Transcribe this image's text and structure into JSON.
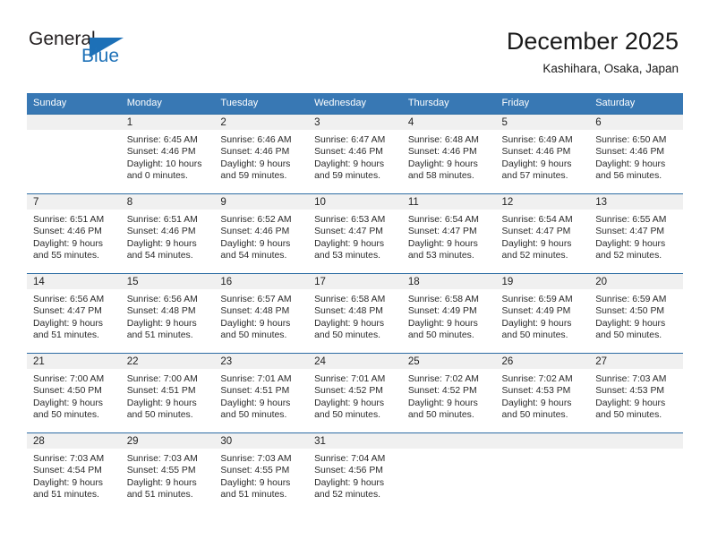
{
  "brand": {
    "name_top": "General",
    "name_bottom": "Blue",
    "accent_color": "#1d70b7",
    "logo_icon": "triangle-icon"
  },
  "header": {
    "title": "December 2025",
    "subtitle": "Kashihara, Osaka, Japan"
  },
  "calendar": {
    "header_bg": "#3878b4",
    "row_separator_color": "#2e6da4",
    "daynum_band_bg": "#f0f0f0",
    "weekdays": [
      "Sunday",
      "Monday",
      "Tuesday",
      "Wednesday",
      "Thursday",
      "Friday",
      "Saturday"
    ],
    "weeks": [
      [
        {
          "day": "",
          "sunrise": "",
          "sunset": "",
          "daylight_line1": "",
          "daylight_line2": "",
          "empty": true
        },
        {
          "day": "1",
          "sunrise": "Sunrise: 6:45 AM",
          "sunset": "Sunset: 4:46 PM",
          "daylight_line1": "Daylight: 10 hours",
          "daylight_line2": "and 0 minutes."
        },
        {
          "day": "2",
          "sunrise": "Sunrise: 6:46 AM",
          "sunset": "Sunset: 4:46 PM",
          "daylight_line1": "Daylight: 9 hours",
          "daylight_line2": "and 59 minutes."
        },
        {
          "day": "3",
          "sunrise": "Sunrise: 6:47 AM",
          "sunset": "Sunset: 4:46 PM",
          "daylight_line1": "Daylight: 9 hours",
          "daylight_line2": "and 59 minutes."
        },
        {
          "day": "4",
          "sunrise": "Sunrise: 6:48 AM",
          "sunset": "Sunset: 4:46 PM",
          "daylight_line1": "Daylight: 9 hours",
          "daylight_line2": "and 58 minutes."
        },
        {
          "day": "5",
          "sunrise": "Sunrise: 6:49 AM",
          "sunset": "Sunset: 4:46 PM",
          "daylight_line1": "Daylight: 9 hours",
          "daylight_line2": "and 57 minutes."
        },
        {
          "day": "6",
          "sunrise": "Sunrise: 6:50 AM",
          "sunset": "Sunset: 4:46 PM",
          "daylight_line1": "Daylight: 9 hours",
          "daylight_line2": "and 56 minutes."
        }
      ],
      [
        {
          "day": "7",
          "sunrise": "Sunrise: 6:51 AM",
          "sunset": "Sunset: 4:46 PM",
          "daylight_line1": "Daylight: 9 hours",
          "daylight_line2": "and 55 minutes."
        },
        {
          "day": "8",
          "sunrise": "Sunrise: 6:51 AM",
          "sunset": "Sunset: 4:46 PM",
          "daylight_line1": "Daylight: 9 hours",
          "daylight_line2": "and 54 minutes."
        },
        {
          "day": "9",
          "sunrise": "Sunrise: 6:52 AM",
          "sunset": "Sunset: 4:46 PM",
          "daylight_line1": "Daylight: 9 hours",
          "daylight_line2": "and 54 minutes."
        },
        {
          "day": "10",
          "sunrise": "Sunrise: 6:53 AM",
          "sunset": "Sunset: 4:47 PM",
          "daylight_line1": "Daylight: 9 hours",
          "daylight_line2": "and 53 minutes."
        },
        {
          "day": "11",
          "sunrise": "Sunrise: 6:54 AM",
          "sunset": "Sunset: 4:47 PM",
          "daylight_line1": "Daylight: 9 hours",
          "daylight_line2": "and 53 minutes."
        },
        {
          "day": "12",
          "sunrise": "Sunrise: 6:54 AM",
          "sunset": "Sunset: 4:47 PM",
          "daylight_line1": "Daylight: 9 hours",
          "daylight_line2": "and 52 minutes."
        },
        {
          "day": "13",
          "sunrise": "Sunrise: 6:55 AM",
          "sunset": "Sunset: 4:47 PM",
          "daylight_line1": "Daylight: 9 hours",
          "daylight_line2": "and 52 minutes."
        }
      ],
      [
        {
          "day": "14",
          "sunrise": "Sunrise: 6:56 AM",
          "sunset": "Sunset: 4:47 PM",
          "daylight_line1": "Daylight: 9 hours",
          "daylight_line2": "and 51 minutes."
        },
        {
          "day": "15",
          "sunrise": "Sunrise: 6:56 AM",
          "sunset": "Sunset: 4:48 PM",
          "daylight_line1": "Daylight: 9 hours",
          "daylight_line2": "and 51 minutes."
        },
        {
          "day": "16",
          "sunrise": "Sunrise: 6:57 AM",
          "sunset": "Sunset: 4:48 PM",
          "daylight_line1": "Daylight: 9 hours",
          "daylight_line2": "and 50 minutes."
        },
        {
          "day": "17",
          "sunrise": "Sunrise: 6:58 AM",
          "sunset": "Sunset: 4:48 PM",
          "daylight_line1": "Daylight: 9 hours",
          "daylight_line2": "and 50 minutes."
        },
        {
          "day": "18",
          "sunrise": "Sunrise: 6:58 AM",
          "sunset": "Sunset: 4:49 PM",
          "daylight_line1": "Daylight: 9 hours",
          "daylight_line2": "and 50 minutes."
        },
        {
          "day": "19",
          "sunrise": "Sunrise: 6:59 AM",
          "sunset": "Sunset: 4:49 PM",
          "daylight_line1": "Daylight: 9 hours",
          "daylight_line2": "and 50 minutes."
        },
        {
          "day": "20",
          "sunrise": "Sunrise: 6:59 AM",
          "sunset": "Sunset: 4:50 PM",
          "daylight_line1": "Daylight: 9 hours",
          "daylight_line2": "and 50 minutes."
        }
      ],
      [
        {
          "day": "21",
          "sunrise": "Sunrise: 7:00 AM",
          "sunset": "Sunset: 4:50 PM",
          "daylight_line1": "Daylight: 9 hours",
          "daylight_line2": "and 50 minutes."
        },
        {
          "day": "22",
          "sunrise": "Sunrise: 7:00 AM",
          "sunset": "Sunset: 4:51 PM",
          "daylight_line1": "Daylight: 9 hours",
          "daylight_line2": "and 50 minutes."
        },
        {
          "day": "23",
          "sunrise": "Sunrise: 7:01 AM",
          "sunset": "Sunset: 4:51 PM",
          "daylight_line1": "Daylight: 9 hours",
          "daylight_line2": "and 50 minutes."
        },
        {
          "day": "24",
          "sunrise": "Sunrise: 7:01 AM",
          "sunset": "Sunset: 4:52 PM",
          "daylight_line1": "Daylight: 9 hours",
          "daylight_line2": "and 50 minutes."
        },
        {
          "day": "25",
          "sunrise": "Sunrise: 7:02 AM",
          "sunset": "Sunset: 4:52 PM",
          "daylight_line1": "Daylight: 9 hours",
          "daylight_line2": "and 50 minutes."
        },
        {
          "day": "26",
          "sunrise": "Sunrise: 7:02 AM",
          "sunset": "Sunset: 4:53 PM",
          "daylight_line1": "Daylight: 9 hours",
          "daylight_line2": "and 50 minutes."
        },
        {
          "day": "27",
          "sunrise": "Sunrise: 7:03 AM",
          "sunset": "Sunset: 4:53 PM",
          "daylight_line1": "Daylight: 9 hours",
          "daylight_line2": "and 50 minutes."
        }
      ],
      [
        {
          "day": "28",
          "sunrise": "Sunrise: 7:03 AM",
          "sunset": "Sunset: 4:54 PM",
          "daylight_line1": "Daylight: 9 hours",
          "daylight_line2": "and 51 minutes."
        },
        {
          "day": "29",
          "sunrise": "Sunrise: 7:03 AM",
          "sunset": "Sunset: 4:55 PM",
          "daylight_line1": "Daylight: 9 hours",
          "daylight_line2": "and 51 minutes."
        },
        {
          "day": "30",
          "sunrise": "Sunrise: 7:03 AM",
          "sunset": "Sunset: 4:55 PM",
          "daylight_line1": "Daylight: 9 hours",
          "daylight_line2": "and 51 minutes."
        },
        {
          "day": "31",
          "sunrise": "Sunrise: 7:04 AM",
          "sunset": "Sunset: 4:56 PM",
          "daylight_line1": "Daylight: 9 hours",
          "daylight_line2": "and 52 minutes."
        },
        {
          "day": "",
          "sunrise": "",
          "sunset": "",
          "daylight_line1": "",
          "daylight_line2": "",
          "empty": true
        },
        {
          "day": "",
          "sunrise": "",
          "sunset": "",
          "daylight_line1": "",
          "daylight_line2": "",
          "empty": true
        },
        {
          "day": "",
          "sunrise": "",
          "sunset": "",
          "daylight_line1": "",
          "daylight_line2": "",
          "empty": true
        }
      ]
    ]
  }
}
